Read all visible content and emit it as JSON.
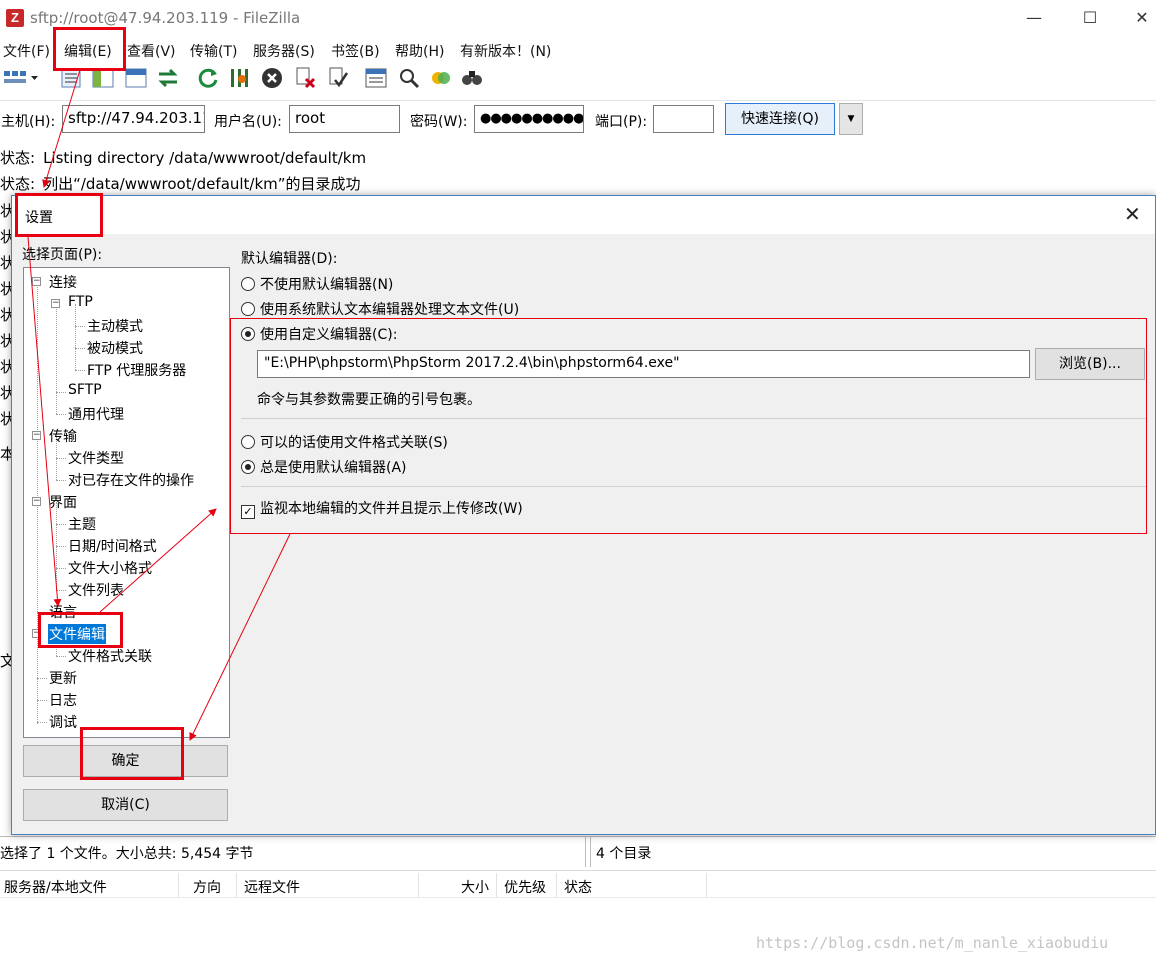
{
  "window": {
    "title": "sftp://root@47.94.203.119 - FileZilla",
    "app_icon": "Z",
    "minimize": "—",
    "maximize": "☐",
    "close": "✕"
  },
  "menu": [
    "文件(F)",
    "编辑(E)",
    "查看(V)",
    "传输(T)",
    "服务器(S)",
    "书签(B)",
    "帮助(H)",
    "有新版本！(N)"
  ],
  "toolbar_icons": [
    "site-manager-icon",
    "toggle-log-icon",
    "toggle-local-tree-icon",
    "toggle-remote-tree-icon",
    "toggle-queue-icon",
    "refresh-icon",
    "process-queue-icon",
    "cancel-icon",
    "disconnect-icon",
    "reconnect-icon",
    "filter-icon",
    "compare-icon",
    "sync-browse-icon",
    "search-icon"
  ],
  "quickconnect": {
    "host_label": "主机(H):",
    "host_value": "sftp://47.94.203.11",
    "user_label": "用户名(U):",
    "user_value": "root",
    "pass_label": "密码(W):",
    "pass_value": "●●●●●●●●●●",
    "port_label": "端口(P):",
    "port_value": "",
    "button": "快速连接(Q)",
    "dropdown": "▼"
  },
  "log": [
    {
      "label": "状态:",
      "message": "Listing directory /data/wwwroot/default/km"
    },
    {
      "label": "状态:",
      "message": "列出“/data/wwwroot/default/km”的目录成功"
    }
  ],
  "peek_chars": [
    "状",
    "状",
    "状",
    "状",
    "状",
    "状",
    "状",
    "状",
    "状",
    "本",
    "文"
  ],
  "dialog": {
    "title": "设置",
    "close": "✕",
    "pages_label": "选择页面(P):",
    "tree": {
      "connection": "连接",
      "ftp": "FTP",
      "active_mode": "主动模式",
      "passive_mode": "被动模式",
      "ftp_proxy": "FTP 代理服务器",
      "sftp": "SFTP",
      "generic_proxy": "通用代理",
      "transfer": "传输",
      "file_types": "文件类型",
      "existing_files": "对已存在文件的操作",
      "interface": "界面",
      "themes": "主题",
      "datetime_format": "日期/时间格式",
      "filesize_format": "文件大小格式",
      "file_lists": "文件列表",
      "language": "语言",
      "file_editing": "文件编辑",
      "filetype_assoc": "文件格式关联",
      "updates": "更新",
      "logging": "日志",
      "debug": "调试"
    },
    "ok": "确定",
    "cancel": "取消(C)",
    "editor_label": "默认编辑器(D):",
    "opt_none": "不使用默认编辑器(N)",
    "opt_system": "使用系统默认文本编辑器处理文本文件(U)",
    "opt_custom": "使用自定义编辑器(C):",
    "custom_path": "\"E:\\PHP\\phpstorm\\PhpStorm 2017.2.4\\bin\\phpstorm64.exe\"",
    "browse": "浏览(B)...",
    "hint": "命令与其参数需要正确的引号包裹。",
    "opt_assoc": "可以的话使用文件格式关联(S)",
    "opt_always": "总是使用默认编辑器(A)",
    "watch_label": "监视本地编辑的文件并且提示上传修改(W)",
    "selected_editor": "custom",
    "selected_assoc": "always",
    "watch_checked": true
  },
  "status": {
    "left": "选择了 1 个文件。大小总共: 5,454 字节",
    "right": "4 个目录"
  },
  "queue_columns": [
    "服务器/本地文件",
    "方向",
    "远程文件",
    "大小",
    "优先级",
    "状态"
  ],
  "watermark": "https://blog.csdn.net/m_nanle_xiaobudiu",
  "colors": {
    "annotation": "#e60012",
    "selection": "#0078d7",
    "accent": "#2d7bd6"
  }
}
